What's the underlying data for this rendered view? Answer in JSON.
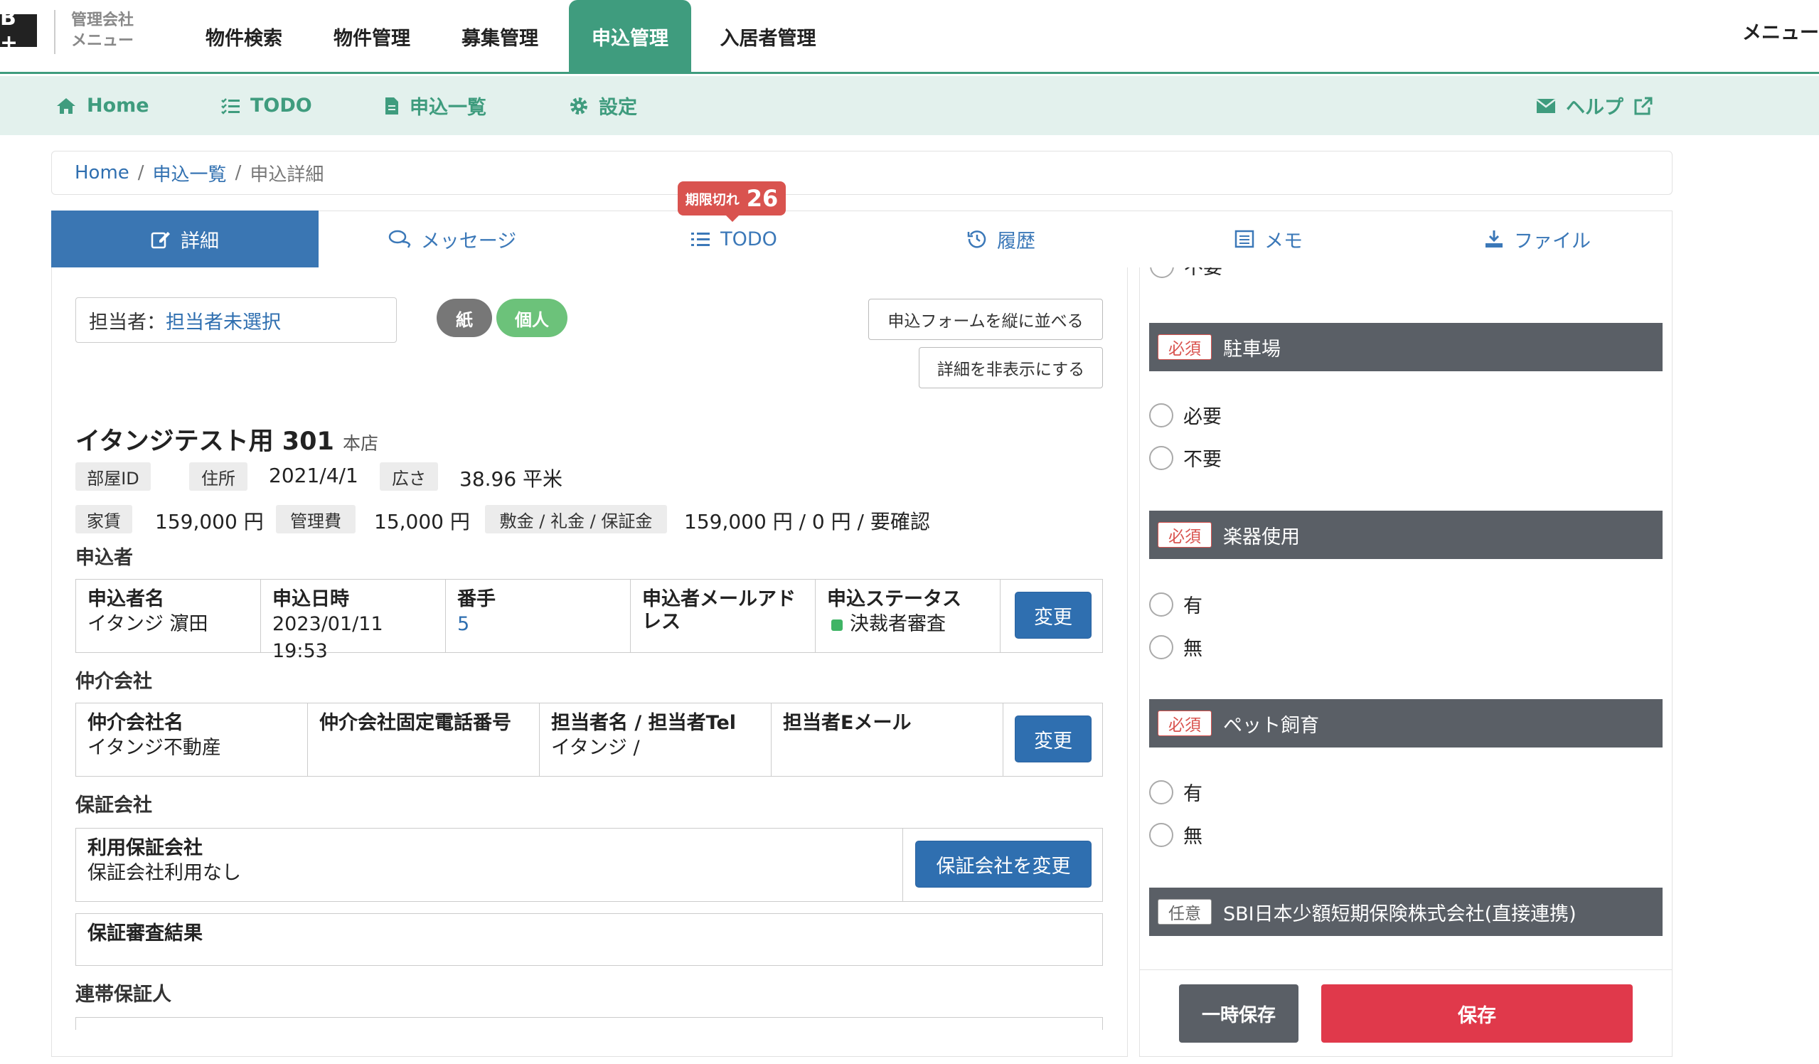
{
  "header": {
    "logo": "B +",
    "company_menu_line1": "管理会社",
    "company_menu_line2": "メニュー",
    "nav": [
      "物件検索",
      "物件管理",
      "募集管理",
      "申込管理",
      "入居者管理"
    ],
    "active_nav": "申込管理",
    "menu_right": "メニュー"
  },
  "subnav": {
    "home": "Home",
    "todo": "TODO",
    "applications": "申込一覧",
    "settings": "設定",
    "help": "ヘルプ"
  },
  "breadcrumb": {
    "home": "Home",
    "sep": "/",
    "list": "申込一覧",
    "current": "申込詳細"
  },
  "tabs": {
    "detail": "詳細",
    "message": "メッセージ",
    "todo": "TODO",
    "history": "履歴",
    "memo": "メモ",
    "file": "ファイル",
    "overdue_label": "期限切れ",
    "overdue_count": "26"
  },
  "assignee": {
    "label": "担当者：",
    "value": "担当者未選択"
  },
  "pills": {
    "paper": "紙",
    "individual": "個人"
  },
  "buttons": {
    "arrange_vertical": "申込フォームを縦に並べる",
    "hide_details": "詳細を非表示にする"
  },
  "property": {
    "name": "イタンジテスト用 301",
    "branch": "本店",
    "room_id_label": "部屋ID",
    "address_label": "住所",
    "date": "2021/4/1",
    "area_label": "広さ",
    "area_value": "38.96 平米",
    "rent_label": "家賃",
    "rent_value": "159,000 円",
    "mgmt_label": "管理費",
    "mgmt_value": "15,000 円",
    "deposit_label": "敷金 / 礼金 / 保証金",
    "deposit_value": "159,000 円 / 0 円 / 要確認"
  },
  "applicant": {
    "section": "申込者",
    "name_h": "申込者名",
    "name_v": "イタンジ 濵田",
    "date_h": "申込日時",
    "date_v": "2023/01/11 19:53",
    "number_h": "番手",
    "number_v": "5",
    "email_h": "申込者メールアドレス",
    "status_h": "申込ステータス",
    "status_v": "決裁者審査",
    "change": "変更"
  },
  "broker": {
    "section": "仲介会社",
    "name_h": "仲介会社名",
    "name_v": "イタンジ不動産",
    "phone_h": "仲介会社固定電話番号",
    "contact_h": "担当者名 / 担当者Tel",
    "contact_v": "イタンジ /",
    "email_h": "担当者Eメール",
    "change": "変更"
  },
  "guarantor": {
    "section": "保証会社",
    "company_h": "利用保証会社",
    "company_v": "保証会社利用なし",
    "change": "保証会社を変更",
    "result_h": "保証審査結果"
  },
  "joint": {
    "section": "連帯保証人"
  },
  "right": {
    "clipped_option": "不要",
    "questions": [
      {
        "badge": "必須",
        "title": "駐車場",
        "options": [
          "必要",
          "不要"
        ]
      },
      {
        "badge": "必須",
        "title": "楽器使用",
        "options": [
          "有",
          "無"
        ]
      },
      {
        "badge": "必須",
        "title": "ペット飼育",
        "options": [
          "有",
          "無"
        ]
      },
      {
        "badge": "任意",
        "title": "SBI日本少額短期保険株式会社(直接連携)"
      }
    ],
    "temp_save": "一時保存",
    "save": "保存"
  },
  "colors": {
    "brand_green": "#3f9c7e",
    "tab_blue": "#3a76b3",
    "danger": "#e0394b",
    "header_gray": "#5a5f66"
  }
}
